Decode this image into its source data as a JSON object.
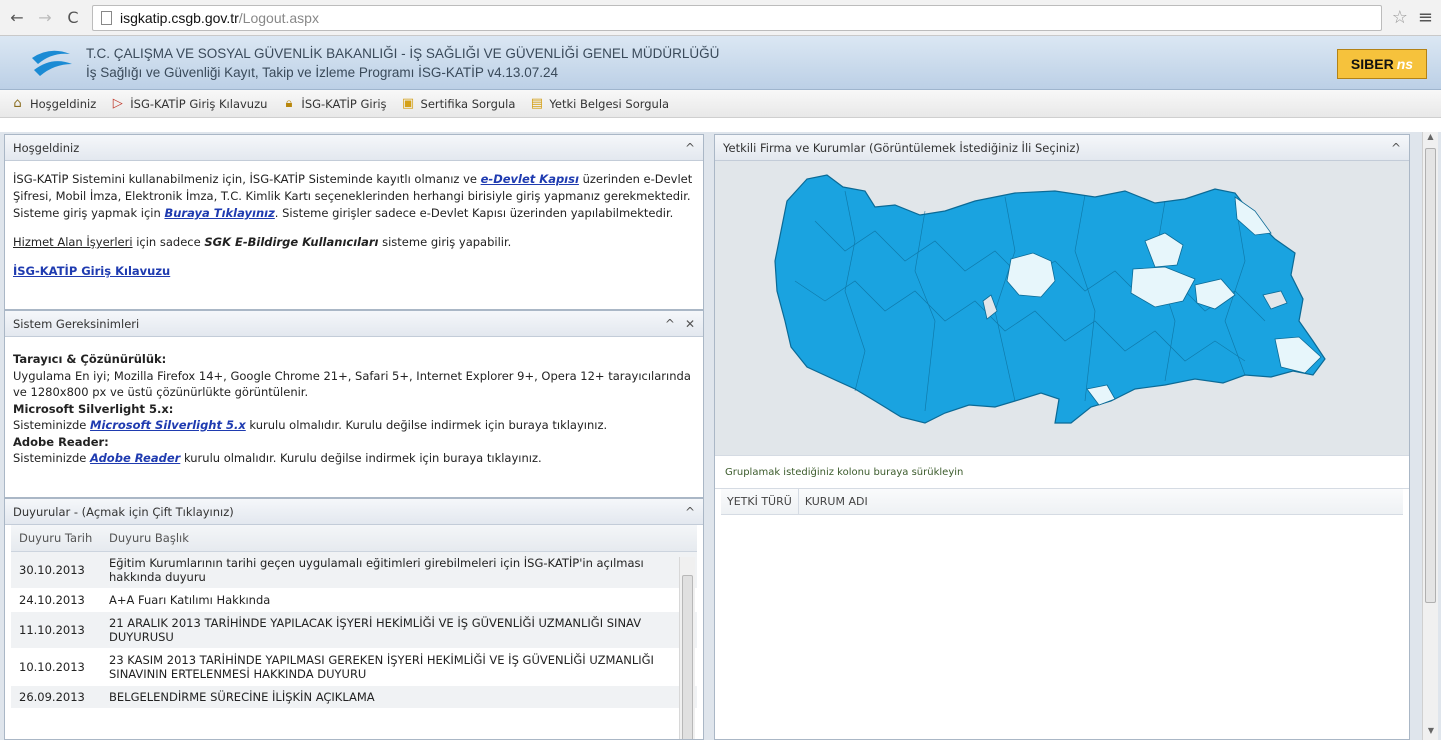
{
  "browser": {
    "url_host": "isgkatip.csgb.gov.tr",
    "url_path": "/Logout.aspx"
  },
  "banner": {
    "line1": "T.C. ÇALIŞMA VE SOSYAL GÜVENLİK BAKANLIĞI - İŞ SAĞLIĞI VE GÜVENLİĞİ GENEL MÜDÜRLÜĞÜ",
    "line2": "İş Sağlığı ve Güvenliği Kayıt, Takip ve İzleme Programı İSG-KATİP v4.13.07.24",
    "brand": "SIBER",
    "brand_suffix": "ns"
  },
  "toolbar": {
    "items": [
      {
        "label": "Hoşgeldiniz",
        "icon": "home-icon"
      },
      {
        "label": "İSG-KATİP Giriş Kılavuzu",
        "icon": "pdf-icon"
      },
      {
        "label": "İSG-KATİP Giriş",
        "icon": "lock-icon"
      },
      {
        "label": "Sertifika Sorgula",
        "icon": "certificate-icon"
      },
      {
        "label": "Yetki Belgesi Sorgula",
        "icon": "document-icon"
      }
    ]
  },
  "welcome": {
    "title": "Hoşgeldiniz",
    "p1_a": "İSG-KATİP Sistemini kullanabilmeniz için, İSG-KATİP Sisteminde kayıtlı olmanız ve ",
    "p1_link": "e-Devlet Kapısı",
    "p1_b": " üzerinden e-Devlet Şifresi, Mobil İmza, Elektronik İmza, T.C. Kimlik Kartı seçeneklerinden herhangi birisiyle giriş yapmanız gerekmektedir. Sisteme giriş yapmak için ",
    "p1_link2": "Buraya Tıklayınız",
    "p1_c": ". Sisteme girişler sadece e-Devlet Kapısı üzerinden yapılabilmektedir.",
    "p2_a": "Hizmet Alan İşyerleri",
    "p2_b": " için sadece ",
    "p2_bold": "SGK E-Bildirge Kullanıcıları",
    "p2_c": " sisteme giriş yapabilir.",
    "guide_link": "İSG-KATİP Giriş Kılavuzu"
  },
  "requirements": {
    "title": "Sistem Gereksinimleri",
    "h1": "Tarayıcı & Çözünürülük:",
    "t1": "Uygulama En iyi; Mozilla Firefox 14+, Google Chrome 21+, Safari 5+, Internet Explorer 9+, Opera 12+ tarayıcılarında ve 1280x800 px ve üstü çözünürlükte görüntülenir.",
    "h2": "Microsoft Silverlight 5.x:",
    "t2_a": "Sisteminizde ",
    "t2_link": "Microsoft Silverlight 5.x",
    "t2_b": " kurulu olmalıdır. Kurulu değilse indirmek için buraya tıklayınız.",
    "h3": "Adobe Reader:",
    "t3_a": "Sisteminizde ",
    "t3_link": "Adobe Reader",
    "t3_b": " kurulu olmalıdır. Kurulu değilse indirmek için buraya tıklayınız."
  },
  "announcements": {
    "title": "Duyurular - (Açmak için Çift Tıklayınız)",
    "col_date": "Duyuru Tarih",
    "col_title": "Duyuru Başlık",
    "rows": [
      {
        "date": "30.10.2013",
        "title": "Eğitim Kurumlarının tarihi geçen uygulamalı eğitimleri girebilmeleri için İSG-KATİP'in açılması hakkında duyuru"
      },
      {
        "date": "24.10.2013",
        "title": "A+A Fuarı Katılımı Hakkında"
      },
      {
        "date": "11.10.2013",
        "title": "21 ARALIK 2013 TARİHİNDE YAPILACAK İŞYERİ HEKİMLİĞİ VE İŞ GÜVENLİĞİ UZMANLIĞI SINAV DUYURUSU"
      },
      {
        "date": "10.10.2013",
        "title": "23 KASIM 2013 TARİHİNDE YAPILMASI GEREKEN İŞYERİ HEKİMLİĞİ VE İŞ GÜVENLİĞİ UZMANLIĞI SINAVININ ERTELENMESİ HAKKINDA DUYURU"
      },
      {
        "date": "26.09.2013",
        "title": "BELGELENDİRME SÜRECİNE İLİŞKİN AÇIKLAMA"
      }
    ]
  },
  "map_panel": {
    "title": "Yetkili Firma ve Kurumlar (Görüntülemek İstediğiniz İli Seçiniz)",
    "group_hint": "Gruplamak istediğiniz kolonu buraya sürükleyin",
    "col1": "YETKİ TÜRÜ",
    "col2": "KURUM ADI",
    "colors": {
      "province": "#1aa3e0",
      "inactive": "#e7f6fb",
      "border": "#0b6a96"
    }
  }
}
